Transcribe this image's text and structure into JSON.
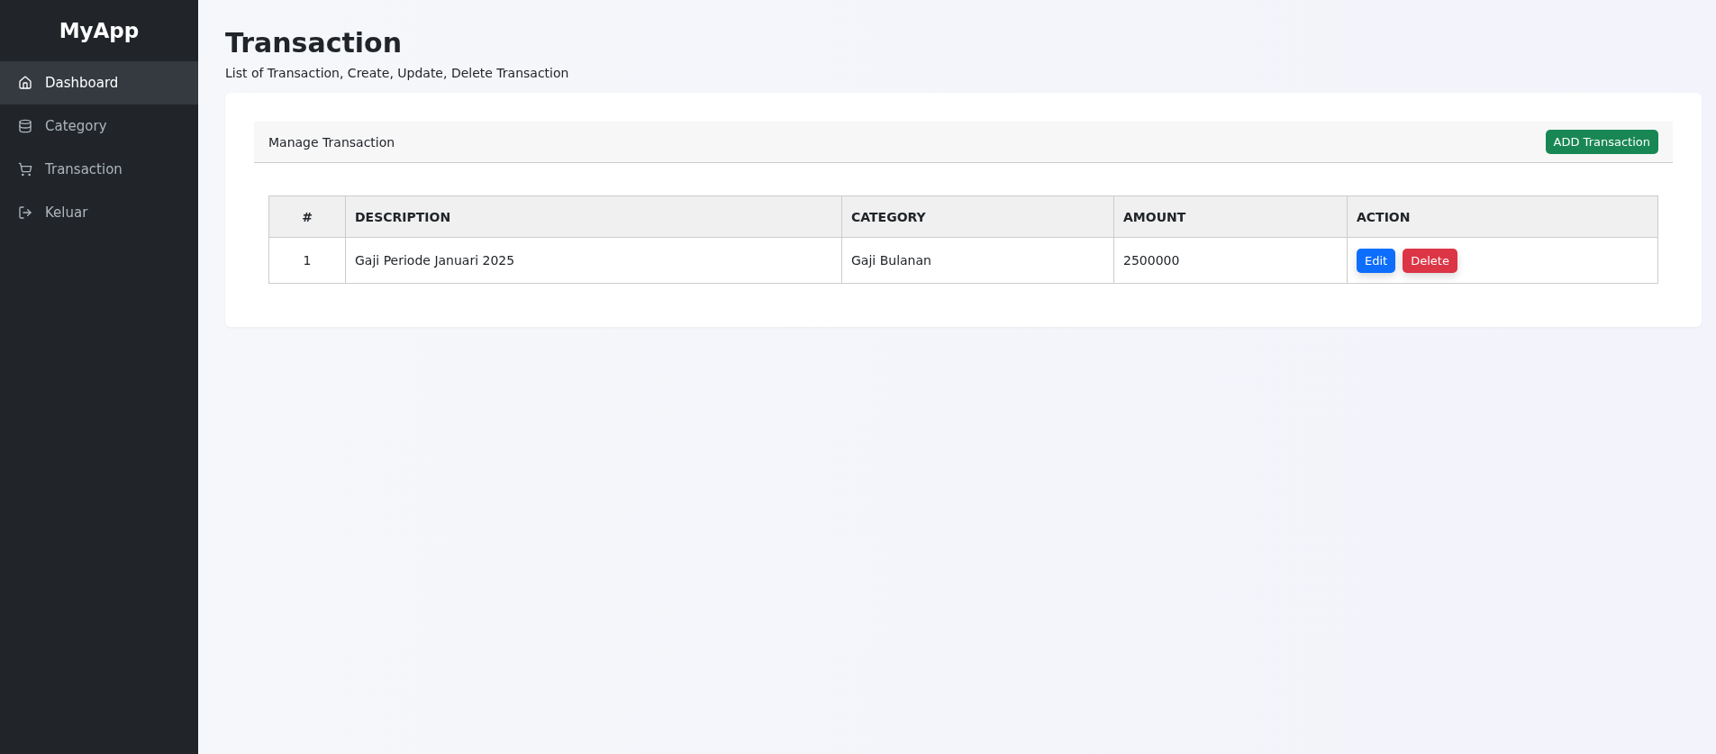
{
  "brand": "MyApp",
  "sidebar": {
    "items": [
      {
        "kind": "home",
        "label": "Dashboard",
        "selected": true
      },
      {
        "kind": "database",
        "label": "Category",
        "selected": false
      },
      {
        "kind": "cart",
        "label": "Transaction",
        "selected": false
      },
      {
        "kind": "logout",
        "label": "Keluar",
        "selected": false
      }
    ]
  },
  "page": {
    "title": "Transaction",
    "subtitle": "List of Transaction, Create, Update, Delete Transaction"
  },
  "card": {
    "header": "Manage Transaction",
    "add_button": "ADD Transaction"
  },
  "table": {
    "columns": [
      "#",
      "DESCRIPTION",
      "CATEGORY",
      "AMOUNT",
      "ACTION"
    ],
    "rows": [
      {
        "number": "1",
        "description": "Gaji Periode Januari 2025",
        "category": "Gaji Bulanan",
        "amount": "2500000",
        "actions": [
          {
            "kind": "edit",
            "label": "Edit"
          },
          {
            "kind": "delete",
            "label": "Delete"
          }
        ]
      }
    ]
  }
}
